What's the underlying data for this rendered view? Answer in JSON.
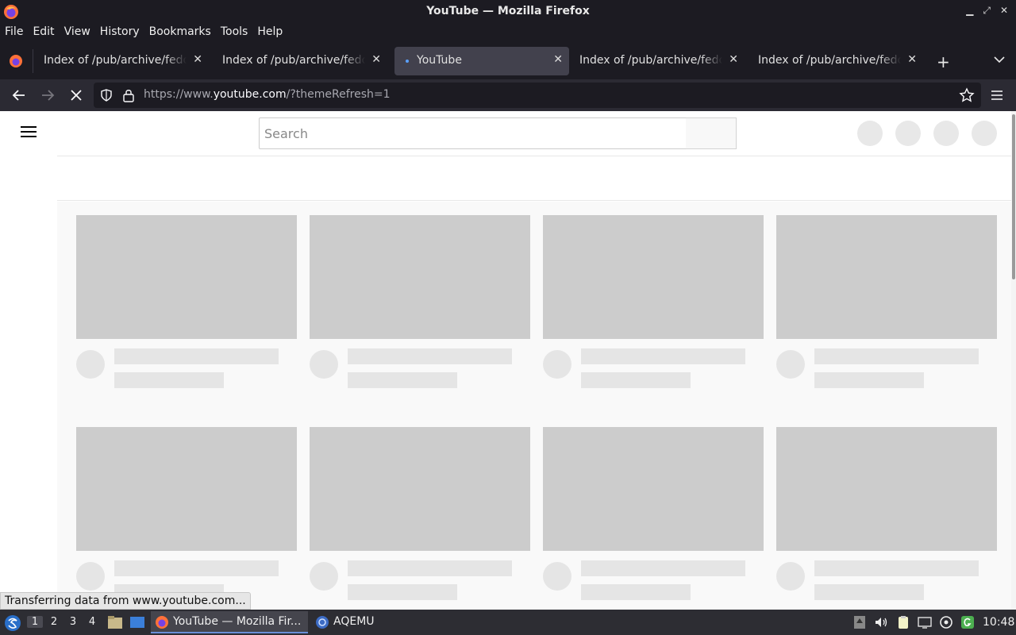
{
  "window": {
    "title": "YouTube — Mozilla Firefox",
    "controls": [
      "minimize-icon",
      "maximize-icon",
      "close-icon"
    ]
  },
  "menu": [
    "File",
    "Edit",
    "View",
    "History",
    "Bookmarks",
    "Tools",
    "Help"
  ],
  "tabs": [
    {
      "label": "Index of /pub/archive/fedora/linux/releases",
      "active": false
    },
    {
      "label": "Index of /pub/archive/fedora/linux/releases",
      "active": false
    },
    {
      "label": "YouTube",
      "active": true,
      "loading": true
    },
    {
      "label": "Index of /pub/archive/fedora/linux/releases",
      "active": false
    },
    {
      "label": "Index of /pub/archive/fedora/linux/releases",
      "active": false
    }
  ],
  "urlbar": {
    "prefix": "https://www.",
    "host": "youtube.com",
    "path": "/?themeRefresh=1"
  },
  "page": {
    "search_placeholder": "Search"
  },
  "status_text": "Transferring data from www.youtube.com...",
  "taskbar": {
    "workspaces": [
      "1",
      "2",
      "3",
      "4"
    ],
    "active_workspace": "1",
    "tasks": [
      {
        "label": "YouTube — Mozilla Fir...",
        "icon": "firefox-icon",
        "active": true
      },
      {
        "label": "AQEMU",
        "icon": "aqemu-icon",
        "active": false
      }
    ],
    "clock": "10:48"
  },
  "colors": {
    "chrome_dark": "#1c1b22",
    "navbar": "#2b2a33",
    "active_tab": "#42414d",
    "skeleton": "#cccccc"
  }
}
